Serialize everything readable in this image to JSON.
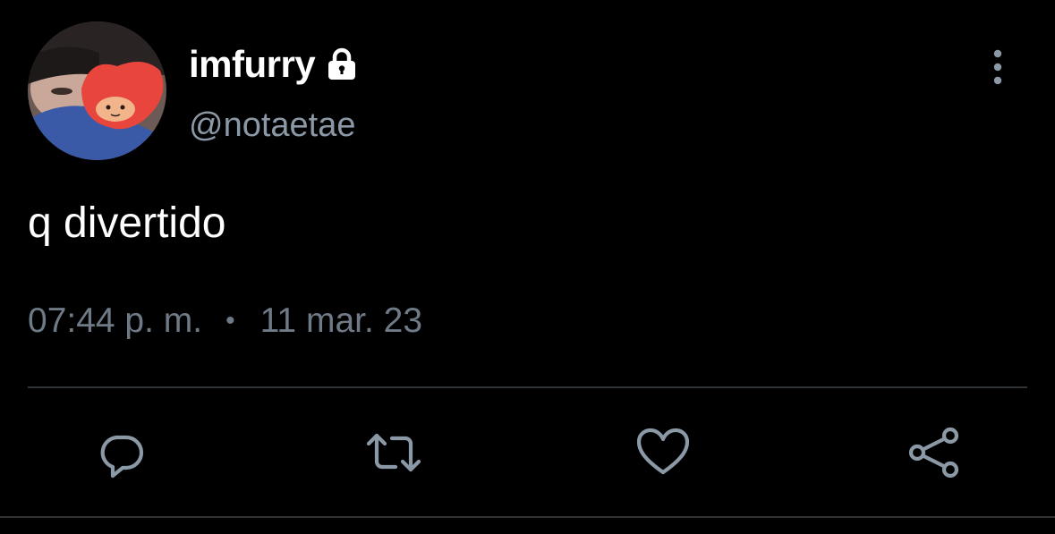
{
  "user": {
    "display_name": "imfurry",
    "handle": "@notaetae",
    "protected": true
  },
  "tweet": {
    "text": "q divertido",
    "time": "07:44 p. m.",
    "separator": "•",
    "date": "11 mar. 23"
  },
  "actions": [
    {
      "name": "reply",
      "icon": "reply-icon"
    },
    {
      "name": "retweet",
      "icon": "retweet-icon"
    },
    {
      "name": "like",
      "icon": "heart-icon"
    },
    {
      "name": "share",
      "icon": "share-icon"
    }
  ],
  "colors": {
    "background": "#000000",
    "primary_text": "#ffffff",
    "secondary_text": "#8b98a5",
    "icon": "#8b98a5",
    "divider": "#2f3336"
  }
}
